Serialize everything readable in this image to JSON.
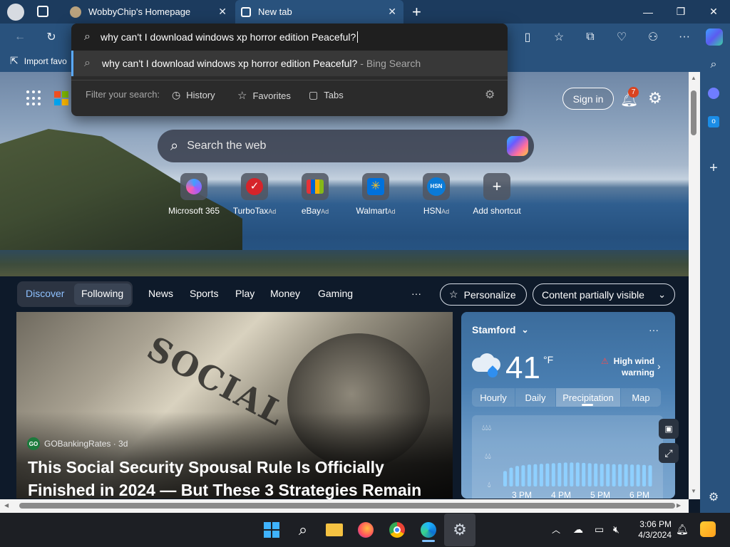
{
  "browser": {
    "tabs": [
      {
        "title": "WobbyChip's Homepage"
      },
      {
        "title": "New tab"
      }
    ],
    "address_query": "why can't I download windows xp horror edition Peaceful?",
    "suggestion": {
      "query": "why can't I download windows xp horror edition Peaceful?",
      "suffix": "- Bing Search"
    },
    "filter": {
      "label": "Filter your search:",
      "history": "History",
      "favorites": "Favorites",
      "tabs": "Tabs"
    },
    "favbar_label": "Import favo"
  },
  "msn": {
    "signin": "Sign in",
    "notif_count": "7",
    "search_placeholder": "Search the web",
    "shortcuts": [
      {
        "label": "Microsoft 365",
        "ad": ""
      },
      {
        "label": "TurboTax",
        "ad": "Ad"
      },
      {
        "label": "eBay",
        "ad": "Ad"
      },
      {
        "label": "Walmart",
        "ad": "Ad"
      },
      {
        "label": "HSN",
        "ad": "Ad"
      },
      {
        "label": "Add shortcut",
        "ad": ""
      }
    ],
    "nav": {
      "discover": "Discover",
      "following": "Following",
      "news": "News",
      "sports": "Sports",
      "play": "Play",
      "money": "Money",
      "gaming": "Gaming",
      "more": "···",
      "personalize": "Personalize",
      "content": "Content partially visible"
    },
    "article": {
      "source": "GOBankingRates · 3d",
      "source_logo": "GO",
      "headline": "This Social Security Spousal Rule Is Officially Finished in 2024 — But These 3 Strategies Remain",
      "image_word": "SOCIAL"
    },
    "weather": {
      "city": "Stamford",
      "temp": "41",
      "unit": "°F",
      "warning_line1": "High wind",
      "warning_line2": "warning",
      "tabs": [
        "Hourly",
        "Daily",
        "Precipitation",
        "Map"
      ],
      "axis": [
        "3 PM",
        "4 PM",
        "5 PM",
        "6 PM"
      ],
      "precip_bars": [
        0.45,
        0.55,
        0.6,
        0.62,
        0.64,
        0.65,
        0.66,
        0.67,
        0.68,
        0.69,
        0.7,
        0.7,
        0.7,
        0.69,
        0.68,
        0.67,
        0.66,
        0.66,
        0.65,
        0.65,
        0.65,
        0.64,
        0.64,
        0.63,
        0.62
      ]
    }
  },
  "hsn_tile": "HSN",
  "taskbar": {
    "time": "3:06 PM",
    "date": "4/3/2024"
  },
  "colors": {
    "frame": "#29527d",
    "titlebar": "#1c3b5e",
    "accent": "#5aa9ff",
    "badge": "#d9431f"
  }
}
